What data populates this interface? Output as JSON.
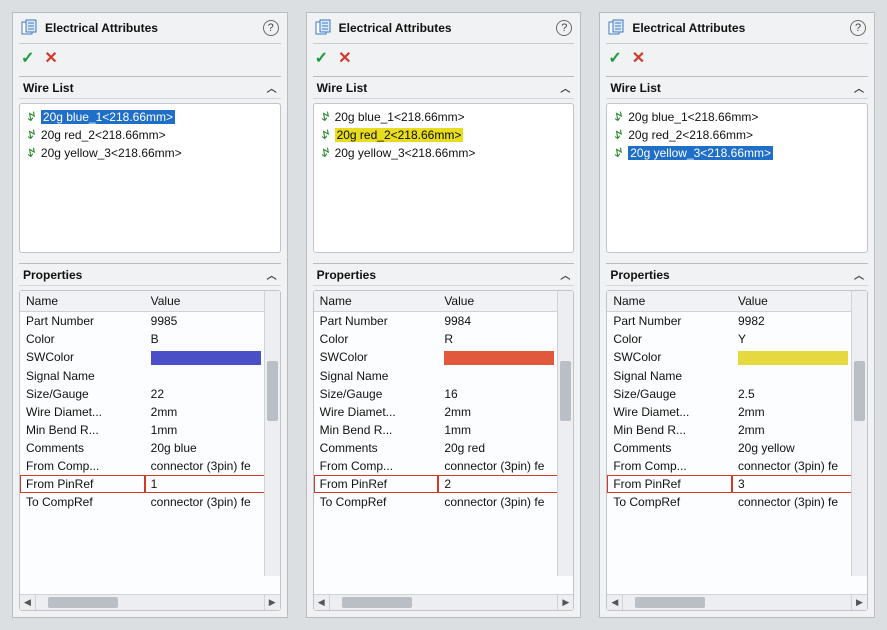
{
  "panels": [
    {
      "title": "Electrical Attributes",
      "wirelist_title": "Wire List",
      "properties_title": "Properties",
      "col_name": "Name",
      "col_value": "Value",
      "wires": [
        {
          "label": "20g blue_1<218.66mm>",
          "selected": "blue"
        },
        {
          "label": "20g red_2<218.66mm>",
          "selected": "none"
        },
        {
          "label": "20g yellow_3<218.66mm>",
          "selected": "none"
        }
      ],
      "props": [
        {
          "name": "Part Number",
          "value": "9985"
        },
        {
          "name": "Color",
          "value": "B"
        },
        {
          "name": "SWColor",
          "value": "",
          "swatch": "#4a4fc7"
        },
        {
          "name": "Signal Name",
          "value": ""
        },
        {
          "name": "Size/Gauge",
          "value": "22"
        },
        {
          "name": "Wire Diamet...",
          "value": "2mm"
        },
        {
          "name": "Min Bend R...",
          "value": "1mm"
        },
        {
          "name": "Comments",
          "value": "20g blue"
        },
        {
          "name": "From Comp...",
          "value": "connector (3pin) fe"
        },
        {
          "name": "From PinRef",
          "value": "1",
          "highlight": true
        },
        {
          "name": "To CompRef",
          "value": "connector (3pin) fe"
        }
      ]
    },
    {
      "title": "Electrical Attributes",
      "wirelist_title": "Wire List",
      "properties_title": "Properties",
      "col_name": "Name",
      "col_value": "Value",
      "wires": [
        {
          "label": "20g blue_1<218.66mm>",
          "selected": "none"
        },
        {
          "label": "20g red_2<218.66mm>",
          "selected": "yellow"
        },
        {
          "label": "20g yellow_3<218.66mm>",
          "selected": "none"
        }
      ],
      "props": [
        {
          "name": "Part Number",
          "value": "9984"
        },
        {
          "name": "Color",
          "value": "R"
        },
        {
          "name": "SWColor",
          "value": "",
          "swatch": "#e2583c"
        },
        {
          "name": "Signal Name",
          "value": ""
        },
        {
          "name": "Size/Gauge",
          "value": "16"
        },
        {
          "name": "Wire Diamet...",
          "value": "2mm"
        },
        {
          "name": "Min Bend R...",
          "value": "1mm"
        },
        {
          "name": "Comments",
          "value": "20g red"
        },
        {
          "name": "From Comp...",
          "value": "connector (3pin) fe"
        },
        {
          "name": "From PinRef",
          "value": "2",
          "highlight": true
        },
        {
          "name": "To CompRef",
          "value": "connector (3pin) fe"
        }
      ]
    },
    {
      "title": "Electrical Attributes",
      "wirelist_title": "Wire List",
      "properties_title": "Properties",
      "col_name": "Name",
      "col_value": "Value",
      "wires": [
        {
          "label": "20g blue_1<218.66mm>",
          "selected": "none"
        },
        {
          "label": "20g red_2<218.66mm>",
          "selected": "none"
        },
        {
          "label": "20g yellow_3<218.66mm>",
          "selected": "blue"
        }
      ],
      "props": [
        {
          "name": "Part Number",
          "value": "9982"
        },
        {
          "name": "Color",
          "value": "Y"
        },
        {
          "name": "SWColor",
          "value": "",
          "swatch": "#e6d940"
        },
        {
          "name": "Signal Name",
          "value": ""
        },
        {
          "name": "Size/Gauge",
          "value": "2.5"
        },
        {
          "name": "Wire Diamet...",
          "value": "2mm"
        },
        {
          "name": "Min Bend R...",
          "value": "2mm"
        },
        {
          "name": "Comments",
          "value": "20g yellow"
        },
        {
          "name": "From Comp...",
          "value": "connector (3pin) fe"
        },
        {
          "name": "From PinRef",
          "value": "3",
          "highlight": true
        },
        {
          "name": "To CompRef",
          "value": "connector (3pin) fe"
        }
      ]
    }
  ]
}
